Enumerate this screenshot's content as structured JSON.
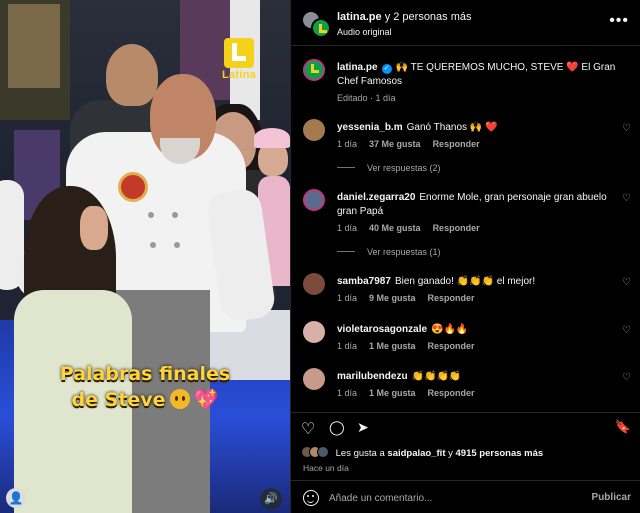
{
  "video": {
    "logo_text": "Latina",
    "caption_line1": "Palabras finales",
    "caption_line2": "de Steve",
    "heart_emoji": "💖",
    "user_icon": "👤",
    "sound_icon": "🔊"
  },
  "header": {
    "account": "latina.pe",
    "others": "y 2 personas más",
    "subtitle": "Audio original",
    "more_icon": "•••"
  },
  "post": {
    "author": "latina.pe",
    "caption": "🙌 TE QUEREMOS MUCHO, STEVE ❤️ El Gran Chef Famosos",
    "meta": "Editado · 1 día"
  },
  "comments": [
    {
      "user": "yessenia_b.m",
      "text": "Ganó Thanos 🙌 ❤️",
      "age": "1 día",
      "likes": "37 Me gusta",
      "reply": "Responder",
      "replies": "Ver respuestas (2)",
      "avatar_color": "#a37b4f"
    },
    {
      "user": "daniel.zegarra20",
      "text": "Enorme Mole, gran personaje gran abuelo gran Papá",
      "age": "1 día",
      "likes": "40 Me gusta",
      "reply": "Responder",
      "replies": "Ver respuestas (1)",
      "avatar_color": "#5b6b8a"
    },
    {
      "user": "samba7987",
      "text": "Bien ganado! 👏👏👏 el mejor!",
      "age": "1 día",
      "likes": "9 Me gusta",
      "reply": "Responder",
      "avatar_color": "#7a4a3a"
    },
    {
      "user": "violetarosagonzale",
      "text": "😍🔥🔥",
      "age": "1 día",
      "likes": "1 Me gusta",
      "reply": "Responder",
      "avatar_color": "#d8b0a8"
    },
    {
      "user": "marilubendezu",
      "text": "👏👏👏👏",
      "age": "1 día",
      "likes": "1 Me gusta",
      "reply": "Responder",
      "avatar_color": "#c79a8a"
    }
  ],
  "actions": {
    "like_icon": "♡",
    "comment_icon": "◯",
    "share_icon": "➤",
    "save_icon": "🔖"
  },
  "likes": {
    "prefix": "Les gusta a",
    "user": "saidpalao_fit",
    "conj": "y",
    "count": "4915 personas más"
  },
  "time_ago": "Hace un día",
  "compose": {
    "placeholder": "Añade un comentario...",
    "post_label": "Publicar"
  },
  "colors": {
    "accent_verified": "#0095f6",
    "brand_yellow": "#f4d21b",
    "brand_green": "#0e9f4c"
  }
}
